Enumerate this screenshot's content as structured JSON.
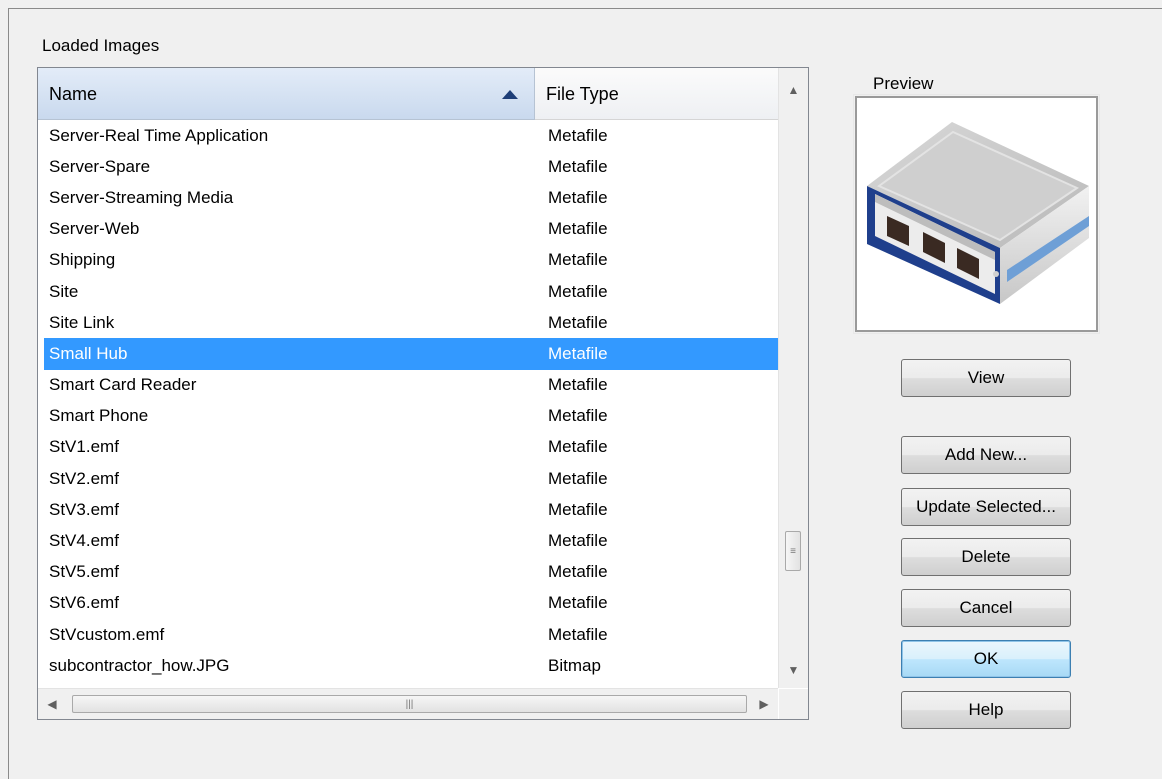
{
  "dialog": {
    "group_label": "Loaded Images",
    "preview_label": "Preview"
  },
  "list": {
    "columns": {
      "name": "Name",
      "file_type": "File Type"
    },
    "sort": "ascending",
    "rows": [
      {
        "name": "Server-Real Time Application",
        "type": "Metafile"
      },
      {
        "name": "Server-Spare",
        "type": "Metafile"
      },
      {
        "name": "Server-Streaming Media",
        "type": "Metafile"
      },
      {
        "name": "Server-Web",
        "type": "Metafile"
      },
      {
        "name": "Shipping",
        "type": "Metafile"
      },
      {
        "name": "Site",
        "type": "Metafile"
      },
      {
        "name": "Site Link",
        "type": "Metafile"
      },
      {
        "name": "Small Hub",
        "type": "Metafile",
        "selected": true
      },
      {
        "name": "Smart Card Reader",
        "type": "Metafile"
      },
      {
        "name": "Smart Phone",
        "type": "Metafile"
      },
      {
        "name": "StV1.emf",
        "type": "Metafile"
      },
      {
        "name": "StV2.emf",
        "type": "Metafile"
      },
      {
        "name": "StV3.emf",
        "type": "Metafile"
      },
      {
        "name": "StV4.emf",
        "type": "Metafile"
      },
      {
        "name": "StV5.emf",
        "type": "Metafile"
      },
      {
        "name": "StV6.emf",
        "type": "Metafile"
      },
      {
        "name": "StVcustom.emf",
        "type": "Metafile"
      },
      {
        "name": "subcontractor_how.JPG",
        "type": "Bitmap"
      }
    ],
    "selection_color": "#3399ff"
  },
  "buttons": {
    "view": "View",
    "add_new": "Add New...",
    "update_selected": "Update Selected...",
    "delete": "Delete",
    "cancel": "Cancel",
    "ok": "OK",
    "help": "Help"
  },
  "icons": {
    "sort": "sort-ascending-icon",
    "preview": "small-hub-icon"
  }
}
